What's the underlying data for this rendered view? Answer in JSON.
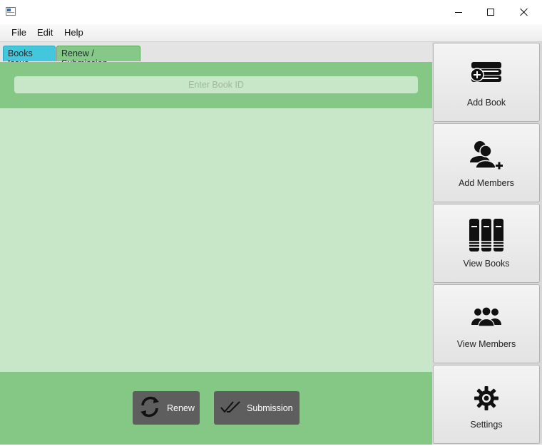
{
  "menu": {
    "file": "File",
    "edit": "Edit",
    "help": "Help"
  },
  "tabs": {
    "books_issue": "Books Issue",
    "renew_submission": "Renew / Submission"
  },
  "search": {
    "placeholder": "Enter Book ID",
    "value": ""
  },
  "actions": {
    "renew": "Renew",
    "submission": "Submission"
  },
  "sidebar": {
    "add_book": "Add Book",
    "add_members": "Add Members",
    "view_books": "View Books",
    "view_members": "View Members",
    "settings": "Settings"
  },
  "colors": {
    "green_band": "#85c885",
    "content_green": "#c8e6c8",
    "active_tab_issue": "#43c7dc",
    "active_tab_renew": "#86c887",
    "action_button": "#5e5e5e"
  },
  "icons": {
    "app": "window-icon",
    "renew": "refresh-icon",
    "submission": "double-check-icon",
    "add_book": "add-book-icon",
    "add_members": "add-user-icon",
    "view_books": "books-icon",
    "view_members": "group-icon",
    "settings": "gear-icon"
  }
}
